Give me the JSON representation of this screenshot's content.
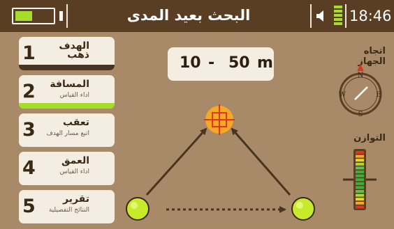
{
  "header": {
    "title": "البحث بعيد المدى",
    "time": "18:46",
    "battery_level": 0.45,
    "signal_bars": 5
  },
  "menu": [
    {
      "number": "1",
      "title": "الهدف",
      "subtitle": "ذهب",
      "state": "selected"
    },
    {
      "number": "2",
      "title": "المسافة",
      "subtitle": "اداء القياس",
      "state": "in-progress"
    },
    {
      "number": "3",
      "title": "تعقب",
      "subtitle": "اتبع مسار الهدف",
      "state": "normal"
    },
    {
      "number": "4",
      "title": "العمق",
      "subtitle": "اداء القياس",
      "state": "normal"
    },
    {
      "number": "5",
      "title": "تقرير",
      "subtitle": "النتائج التفصيلية",
      "state": "normal"
    }
  ],
  "range": {
    "min": "10",
    "dash": "-",
    "max": "50",
    "unit": "m"
  },
  "compass": {
    "label": "اتجاه الجهاز",
    "n": "N",
    "e": "E",
    "s": "S",
    "w": "W"
  },
  "balance": {
    "label": "التوازن"
  },
  "colors": {
    "header": "#5a3e23",
    "background": "#a88a68",
    "card": "#f4ede2",
    "accent_green": "#a6dc2a",
    "target_orange": "#f7a825",
    "crosshair_red": "#d9381e"
  }
}
